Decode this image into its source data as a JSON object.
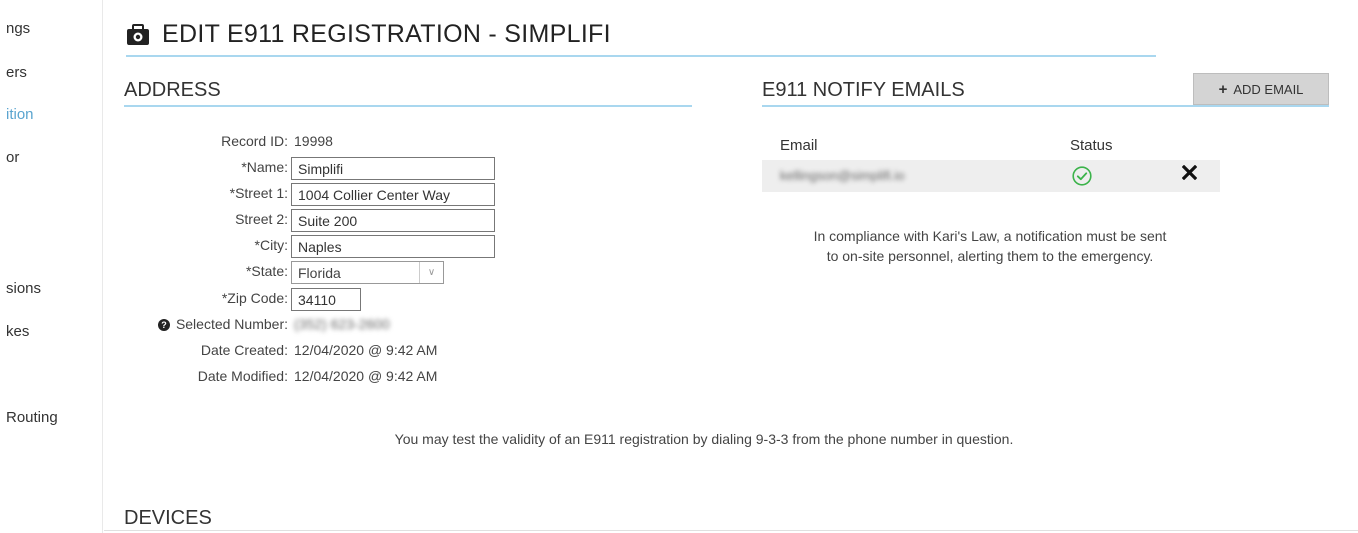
{
  "sidebar": {
    "items": [
      {
        "label": "ngs",
        "active": false
      },
      {
        "label": "ers",
        "active": false
      },
      {
        "label": "ition",
        "active": true
      },
      {
        "label": "or",
        "active": false
      },
      {
        "label": "sions",
        "active": false
      },
      {
        "label": "kes",
        "active": false
      },
      {
        "label": "Routing",
        "active": false
      }
    ]
  },
  "page": {
    "title": "EDIT E911 REGISTRATION - SIMPLIFI",
    "title_icon": "briefcase-icon"
  },
  "address": {
    "heading": "ADDRESS",
    "record_id_label": "Record ID:",
    "record_id": "19998",
    "name_label": "*Name:",
    "name": "Simplifi",
    "street1_label": "*Street 1:",
    "street1": "1004 Collier Center Way",
    "street2_label": "Street 2:",
    "street2": "Suite 200",
    "city_label": "*City:",
    "city": "Naples",
    "state_label": "*State:",
    "state": "Florida",
    "zip_label": "*Zip Code:",
    "zip": "34110",
    "selected_number_label": "Selected Number:",
    "selected_number": "(352) 623-2600",
    "date_created_label": "Date Created:",
    "date_created": "12/04/2020 @ 9:42 AM",
    "date_modified_label": "Date Modified:",
    "date_modified": "12/04/2020 @ 9:42 AM"
  },
  "emails": {
    "heading": "E911 NOTIFY EMAILS",
    "add_button": "ADD EMAIL",
    "col_email": "Email",
    "col_status": "Status",
    "rows": [
      {
        "email": "kellingson@simplifi.io",
        "status": "verified"
      }
    ],
    "notice_line1": "In compliance with Kari's Law, a notification must be sent",
    "notice_line2": "to on-site personnel, alerting them to the emergency."
  },
  "test_notice": "You may test the validity of an E911 registration by dialing 9-3-3 from the phone number in question.",
  "devices": {
    "heading": "DEVICES"
  },
  "colors": {
    "accent": "#5aa4cf",
    "rule": "#a9d7ef",
    "status_ok": "#3bb34a"
  }
}
